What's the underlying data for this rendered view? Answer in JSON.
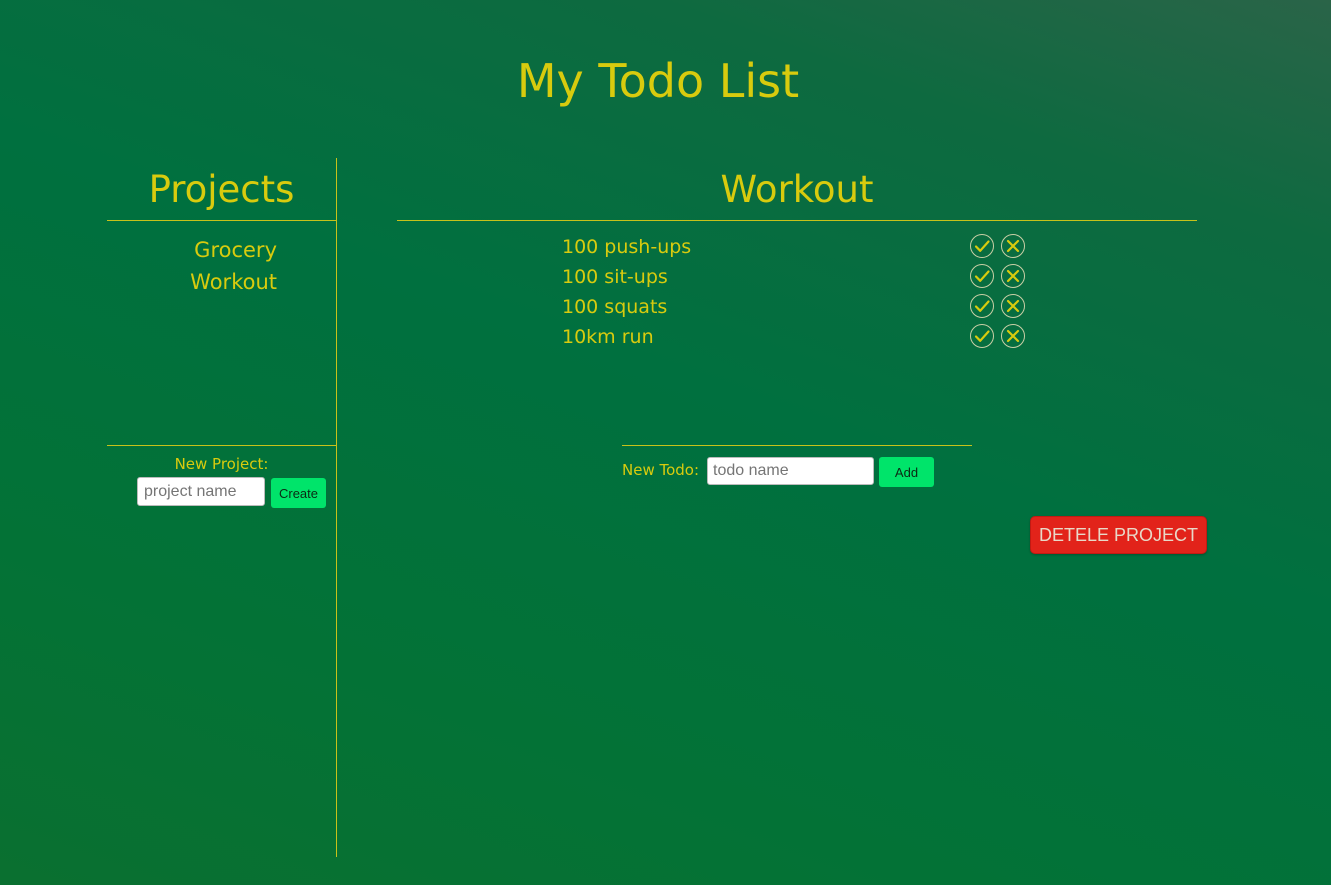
{
  "app": {
    "title": "My Todo List"
  },
  "sidebar": {
    "heading": "Projects",
    "projects": [
      {
        "label": "Grocery"
      },
      {
        "label": "Workout"
      }
    ],
    "new_project": {
      "label": "New Project:",
      "input_value": "",
      "placeholder": "project name",
      "button_label": "Create"
    }
  },
  "main": {
    "heading": "Workout",
    "todos": [
      {
        "text": "100 push-ups",
        "complete_icon": "check-circle-icon",
        "remove_icon": "x-circle-icon"
      },
      {
        "text": "100 sit-ups",
        "complete_icon": "check-circle-icon",
        "remove_icon": "x-circle-icon"
      },
      {
        "text": "100 squats",
        "complete_icon": "check-circle-icon",
        "remove_icon": "x-circle-icon"
      },
      {
        "text": "10km run",
        "complete_icon": "check-circle-icon",
        "remove_icon": "x-circle-icon"
      }
    ],
    "new_todo": {
      "label": "New Todo:",
      "input_value": "",
      "placeholder": "todo name",
      "button_label": "Add"
    },
    "delete_button_label": "DETELE PROJECT"
  },
  "colors": {
    "text_accent": "#d8cb0e",
    "background": "#00703f",
    "button_green": "#00e46a",
    "delete_red": "#e2231a"
  }
}
